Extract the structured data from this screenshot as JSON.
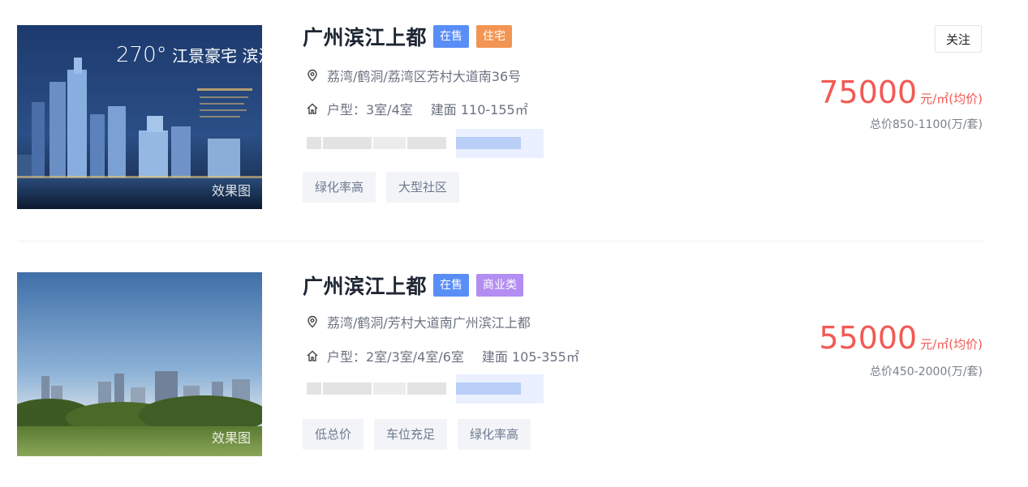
{
  "listings": [
    {
      "title": "广州滨江上都",
      "tags": [
        "在售",
        "住宅"
      ],
      "address": "荔湾/鹤洞/荔湾区芳村大道南36号",
      "layout": "户型：3室/4室",
      "area": "建面 110-155㎡",
      "features": [
        "绿化率高",
        "大型社区"
      ],
      "price": "75000",
      "price_unit": "元/㎡(均价)",
      "total": "总价850-1100(万/套)",
      "image_label": "效果图",
      "image_headline_big": "270°",
      "image_headline": "江景豪宅 滨江生活典"
    },
    {
      "title": "广州滨江上都",
      "tags": [
        "在售",
        "商业类"
      ],
      "address": "荔湾/鹤洞/芳村大道南广州滨江上都",
      "layout": "户型：2室/3室/4室/6室",
      "area": "建面 105-355㎡",
      "features": [
        "低总价",
        "车位充足",
        "绿化率高"
      ],
      "price": "55000",
      "price_unit": "元/㎡(均价)",
      "total": "总价450-2000(万/套)",
      "image_label": "效果图"
    }
  ],
  "follow_label": "关注",
  "colors": {
    "accent_price": "#f25a55",
    "tag_sale": "#5a8ef7",
    "tag_residential": "#f29552",
    "tag_commercial": "#b38df2"
  },
  "icons": {
    "address": "location-pin-icon",
    "layout": "house-icon"
  }
}
